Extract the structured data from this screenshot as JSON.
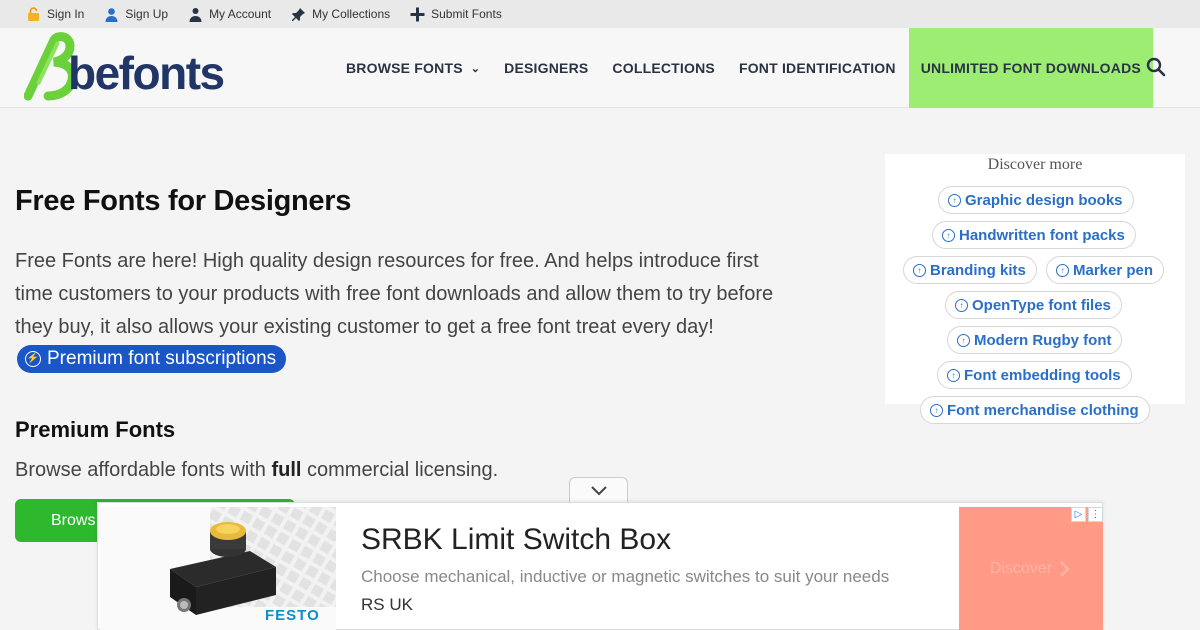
{
  "topbar": {
    "items": [
      {
        "label": "Sign In",
        "icon": "sign-in-icon"
      },
      {
        "label": "Sign Up",
        "icon": "user-icon"
      },
      {
        "label": "My Account",
        "icon": "account-icon"
      },
      {
        "label": "My Collections",
        "icon": "pin-icon"
      },
      {
        "label": "Submit Fonts",
        "icon": "plus-icon"
      }
    ]
  },
  "header": {
    "logo_text": "befonts",
    "nav": [
      {
        "label": "BROWSE FONTS"
      },
      {
        "label": "DESIGNERS"
      },
      {
        "label": "COLLECTIONS"
      },
      {
        "label": "FONT IDENTIFICATION"
      },
      {
        "label": "UNLIMITED FONT DOWNLOADS"
      }
    ],
    "colors": {
      "brand_blue": "#213566",
      "logo_green": "#6ad13a",
      "unlimited_bg": "#9ded72"
    }
  },
  "main": {
    "title": "Free Fonts for Designers",
    "intro": "Free Fonts are here! High quality design resources for free. And helps introduce first time customers to your products with free font downloads and allow them to try before they buy, it also allows your existing customer to get a free font treat every day!",
    "premium_pill": "Premium font subscriptions",
    "premium_title": "Premium Fonts",
    "premium_sub_before": "Browse affordable fonts with ",
    "premium_sub_bold": "full",
    "premium_sub_after": " commercial licensing.",
    "browse_button": "Brows"
  },
  "discover": {
    "title": "Discover more",
    "items": [
      "Graphic design books",
      "Handwritten font packs",
      "Branding kits",
      "Marker pen",
      "OpenType font files",
      "Modern Rugby font",
      "Font embedding tools",
      "Font merchandise clothing"
    ]
  },
  "ad": {
    "headline": "SRBK Limit Switch Box",
    "description": "Choose mechanical, inductive or magnetic switches to suit your needs",
    "source": "RS UK",
    "brand": "FESTO",
    "cta": "Discover",
    "cta_color": "#ff9a86"
  }
}
